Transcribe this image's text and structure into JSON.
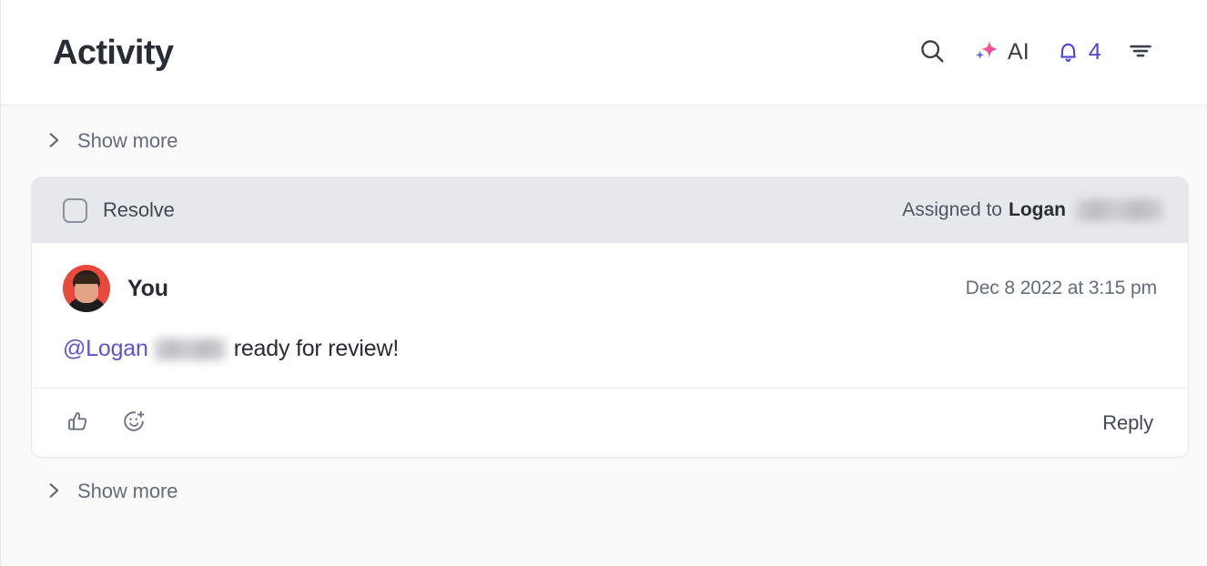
{
  "header": {
    "title": "Activity",
    "actions": {
      "search_icon": "search-icon",
      "ai_label": "AI",
      "ai_icon": "sparkle-ai-icon",
      "bell_icon": "bell-icon",
      "notification_count": "4",
      "filter_icon": "filter-icon"
    }
  },
  "body": {
    "show_more_top": {
      "label": "Show more",
      "icon": "chevron-right-icon"
    },
    "show_more_bottom": {
      "label": "Show more",
      "icon": "chevron-right-icon"
    },
    "comment_card": {
      "resolve": {
        "label": "Resolve",
        "checked": false
      },
      "assignment": {
        "prefix": "Assigned to",
        "name": "Logan",
        "redacted_surname": true
      },
      "comment": {
        "author": "You",
        "avatar": "user-avatar",
        "timestamp": "Dec 8 2022 at 3:15 pm",
        "mention": "@Logan",
        "redacted_mention_surname": true,
        "text": "ready for review!"
      },
      "footer": {
        "thumbs_up_icon": "thumbs-up-icon",
        "add_reaction_icon": "add-reaction-icon",
        "reply_label": "Reply"
      }
    }
  },
  "colors": {
    "accent_purple": "#4f46d6",
    "mention_purple": "#5b54d6",
    "avatar_background": "#e9493b",
    "resolve_bar": "#e7e8ec",
    "page_background": "#fafafa"
  }
}
